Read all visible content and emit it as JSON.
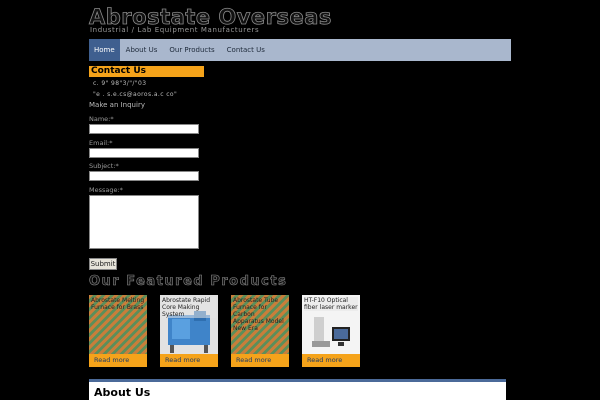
{
  "site": {
    "title": "Abrostate Overseas",
    "tagline": "Industrial / Lab Equipment Manufacturers"
  },
  "nav": {
    "items": [
      "Home",
      "About Us",
      "Our Products",
      "Contact Us"
    ],
    "active_index": 0
  },
  "contact": {
    "heading": "Contact Us",
    "phone_line": "c.  9\" 98\"3/\"/\"03",
    "email_line": "\"e . s.e.cs@aoros.a.c co\"",
    "make_inquiry": "Make an Inquiry"
  },
  "form": {
    "name_label": "Name:*",
    "email_label": "Email:*",
    "subject_label": "Subject:*",
    "message_label": "Message:*",
    "submit_label": "Submit"
  },
  "featured": {
    "heading": "Our Featured Products",
    "products": [
      {
        "name": "Abrostate Melting Furnace for Brass",
        "read_more": "Read more"
      },
      {
        "name": "Abrostate Rapid Core Making System",
        "read_more": "Read more"
      },
      {
        "name": "Abrostate Tube Furnace for Carbon Apparatus Model New Era",
        "read_more": "Read more"
      },
      {
        "name": "HT-F10 Optical fiber laser marker",
        "read_more": "Read more"
      }
    ]
  },
  "about": {
    "heading": "About Us"
  },
  "colors": {
    "accent_orange": "#f5a31a",
    "nav_bg": "#a9b7cd",
    "nav_active": "#3f5f8f"
  }
}
